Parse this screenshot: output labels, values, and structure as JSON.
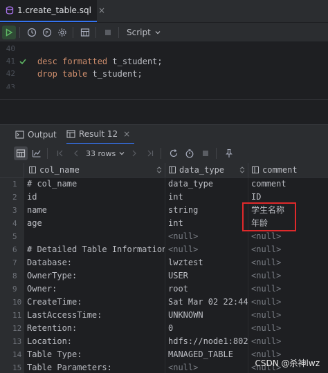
{
  "file_tab": {
    "name": "1.create_table.sql",
    "close": "×"
  },
  "editor_toolbar": {
    "script_label": "Script"
  },
  "editor": {
    "lines": [
      {
        "num": "40",
        "kw1": "",
        "rest": ""
      },
      {
        "num": "41",
        "kw1": "desc formatted",
        "rest": " t_student;"
      },
      {
        "num": "42",
        "kw1": "drop table",
        "rest": " t_student;"
      },
      {
        "num": "43",
        "kw1": "",
        "rest": ""
      }
    ]
  },
  "results_tabs": [
    {
      "label": "Output",
      "icon": "console-icon"
    },
    {
      "label": "Result 12",
      "icon": "table-icon",
      "close": "×"
    }
  ],
  "results_toolbar": {
    "rows_label": "33 rows"
  },
  "columns": [
    "col_name",
    "data_type",
    "comment"
  ],
  "rows": [
    {
      "n": "1",
      "c": [
        "# col_name",
        "data_type",
        "comment"
      ]
    },
    {
      "n": "2",
      "c": [
        "id",
        "int",
        "ID"
      ]
    },
    {
      "n": "3",
      "c": [
        "name",
        "string",
        "学生名称"
      ]
    },
    {
      "n": "4",
      "c": [
        "age",
        "int",
        "年龄"
      ]
    },
    {
      "n": "5",
      "c": [
        "",
        "<null>",
        "<null>"
      ]
    },
    {
      "n": "6",
      "c": [
        "# Detailed Table Information",
        "<null>",
        "<null>"
      ]
    },
    {
      "n": "7",
      "c": [
        "Database:",
        "lwztest",
        "<null>"
      ]
    },
    {
      "n": "8",
      "c": [
        "OwnerType:",
        "USER",
        "<null>"
      ]
    },
    {
      "n": "9",
      "c": [
        "Owner:",
        "root",
        "<null>"
      ]
    },
    {
      "n": "10",
      "c": [
        "CreateTime:",
        "Sat Mar 02 22:44…",
        "<null>"
      ]
    },
    {
      "n": "11",
      "c": [
        "LastAccessTime:",
        "UNKNOWN",
        "<null>"
      ]
    },
    {
      "n": "12",
      "c": [
        "Retention:",
        "0",
        "<null>"
      ]
    },
    {
      "n": "13",
      "c": [
        "Location:",
        "hdfs://node1:802…",
        "<null>"
      ]
    },
    {
      "n": "14",
      "c": [
        "Table Type:",
        "MANAGED_TABLE",
        "<null>"
      ]
    },
    {
      "n": "15",
      "c": [
        "Table Parameters:",
        "<null>",
        "<null>"
      ]
    }
  ],
  "watermark": "CSDN @杀神lwz"
}
